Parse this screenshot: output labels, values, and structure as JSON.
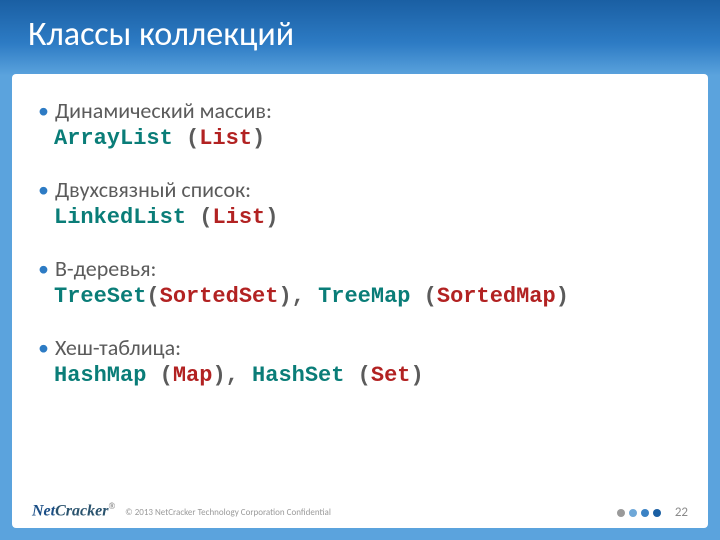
{
  "title": "Классы коллекций",
  "bullet_mark": "•",
  "bullets": [
    {
      "intro": "Динамический массив:",
      "code": {
        "p1": "ArrayList",
        "paren_open": " (",
        "iface1": "List",
        "mid": "",
        "p2": "",
        "paren2_open": "",
        "iface2": "",
        "paren2_close": "",
        "paren_close": ")"
      }
    },
    {
      "intro": "Двухсвязный список:",
      "code": {
        "p1": "LinkedList",
        "paren_open": " (",
        "iface1": "List",
        "mid": "",
        "p2": "",
        "paren2_open": "",
        "iface2": "",
        "paren2_close": "",
        "paren_close": ")"
      }
    },
    {
      "intro": "B-деревья:",
      "code": {
        "p1": "TreeSet",
        "paren_open": "(",
        "iface1": "SortedSet",
        "mid": "), ",
        "p2": "TreeMap",
        "paren2_open": " (",
        "iface2": "SortedMap",
        "paren2_close": ")",
        "paren_close": ""
      }
    },
    {
      "intro": "Хеш-таблица:",
      "code": {
        "p1": "HashMap",
        "paren_open": " (",
        "iface1": "Map",
        "mid": "), ",
        "p2": "HashSet",
        "paren2_open": " (",
        "iface2": "Set",
        "paren2_close": ")",
        "paren_close": ""
      }
    }
  ],
  "footer": {
    "logo_net": "Net",
    "logo_cracker": "Cracker",
    "reg": "®",
    "copyright": "© 2013 NetCracker Technology Corporation Confidential",
    "dot_colors": [
      "#9a9a9a",
      "#6fa8d8",
      "#3b82c4",
      "#1a5fa3"
    ],
    "page": "22"
  }
}
